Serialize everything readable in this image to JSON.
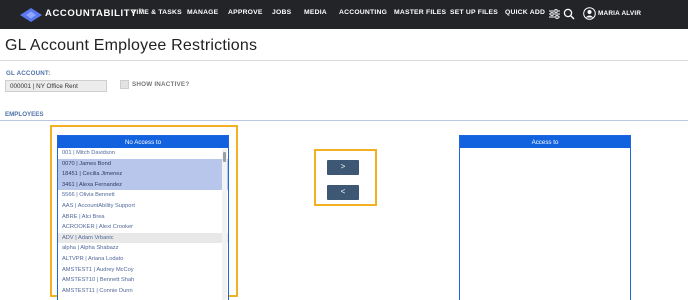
{
  "header": {
    "logo_text": "ACCOUNTABILITY",
    "trademark": "™",
    "nav": [
      "TIME & TASKS",
      "MANAGE",
      "APPROVE",
      "JOBS",
      "MEDIA",
      "ACCOUNTING",
      "MASTER FILES",
      "SET UP FILES",
      "QUICK ADD"
    ],
    "username": "MARIA ALVIR",
    "icons": [
      "sliders-icon",
      "search-icon",
      "user-icon"
    ]
  },
  "page": {
    "title": "GL Account Employee Restrictions"
  },
  "form": {
    "gl_account_label": "GL ACCOUNT:",
    "gl_account_value": "000001 | NY Office Rent",
    "show_inactive_label": "SHOW INACTIVE?",
    "show_inactive_checked": false
  },
  "employees": {
    "section_label": "EMPLOYEES",
    "no_access": {
      "header": "No Access to",
      "items": [
        {
          "label": "001 | Mitch Davidson",
          "state": "normal"
        },
        {
          "label": "0070 | James Bond",
          "state": "selected"
        },
        {
          "label": "18451 | Cecilia Jimenez",
          "state": "selected"
        },
        {
          "label": "3461 | Alexa Fernandez",
          "state": "selected"
        },
        {
          "label": "5566 | Olivia Bennett",
          "state": "normal"
        },
        {
          "label": "AAS | AccountAbility Support",
          "state": "normal"
        },
        {
          "label": "ABRE | Alci Brea",
          "state": "normal"
        },
        {
          "label": "ACROOKER | Alexi Crooker",
          "state": "normal"
        },
        {
          "label": "ADV | Adam Vrbanic",
          "state": "hover"
        },
        {
          "label": "alpha | Alpha Shabazz",
          "state": "normal"
        },
        {
          "label": "ALTVPR | Ariana Lodato",
          "state": "normal"
        },
        {
          "label": "AMSTEST1 | Audrey McCoy",
          "state": "normal"
        },
        {
          "label": "AMSTEST10 | Bennett Shah",
          "state": "normal"
        },
        {
          "label": "AMSTEST11 | Connie Dunn",
          "state": "normal"
        }
      ]
    },
    "access": {
      "header": "Access to",
      "items": []
    },
    "move_right_label": ">",
    "move_left_label": "<"
  },
  "colors": {
    "topbar": "#222427",
    "panel_header": "#1261de",
    "selected_row": "#b9c6ec",
    "button": "#3d5774",
    "highlight": "#f3b022",
    "logo_mark": "#5a78f0"
  }
}
